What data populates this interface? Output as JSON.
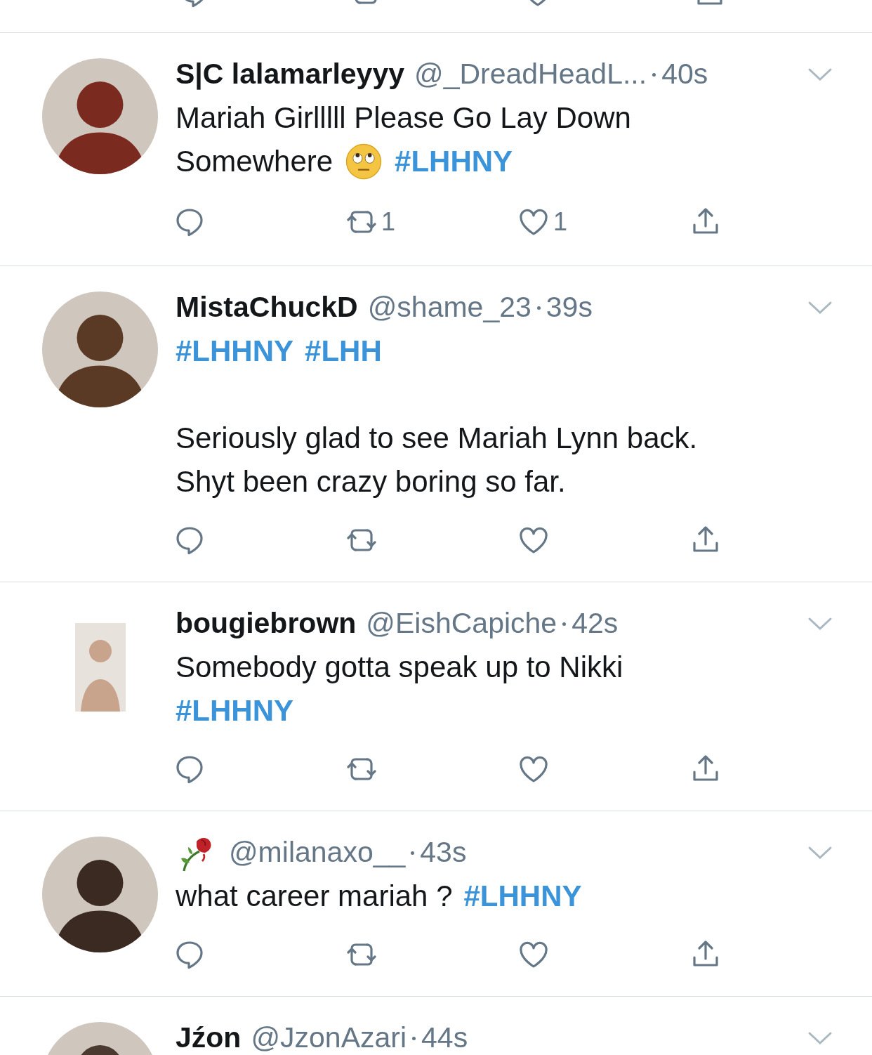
{
  "tweets": [
    {
      "avatar": {
        "kind": "circle"
      },
      "name": "S|C lalamarleyyy",
      "handle": "@_DreadHeadL...",
      "time": "40s",
      "paragraphs": [
        [
          [
            {
              "kind": "text",
              "text": "Mariah Girlllll Please Go Lay Down"
            }
          ],
          [
            {
              "kind": "text",
              "text": "Somewhere"
            },
            {
              "kind": "emoji"
            },
            {
              "kind": "hashtag",
              "text": "#LHHNY"
            }
          ]
        ]
      ],
      "retweets": "1",
      "likes": "1"
    },
    {
      "avatar": {
        "kind": "circle"
      },
      "name": "MistaChuckD",
      "handle": "@shame_23",
      "time": "39s",
      "paragraphs": [
        [
          [
            {
              "kind": "hashtag",
              "text": "#LHHNY"
            },
            {
              "kind": "hashtag",
              "text": "#LHH"
            }
          ]
        ],
        [
          [
            {
              "kind": "text",
              "text": "Seriously glad to see Mariah Lynn back."
            }
          ],
          [
            {
              "kind": "text",
              "text": "Shyt been crazy boring so far."
            }
          ]
        ]
      ]
    },
    {
      "avatar": {
        "kind": "square"
      },
      "name": "bougiebrown",
      "handle": "@EishCapiche",
      "time": "42s",
      "paragraphs": [
        [
          [
            {
              "kind": "text",
              "text": "Somebody gotta speak up to Nikki"
            }
          ],
          [
            {
              "kind": "hashtag",
              "text": "#LHHNY"
            }
          ]
        ]
      ]
    },
    {
      "avatar": {
        "kind": "circle"
      },
      "display_icon": true,
      "handle": "@milanaxo__",
      "time": "43s",
      "paragraphs": [
        [
          [
            {
              "kind": "text",
              "text": "what career mariah ?"
            },
            {
              "kind": "hashtag",
              "text": "#LHHNY"
            }
          ]
        ]
      ]
    },
    {
      "avatar": {
        "kind": "circle"
      },
      "name": "Jźon",
      "handle": "@JzonAzari",
      "time": "44s",
      "partial": true
    }
  ]
}
